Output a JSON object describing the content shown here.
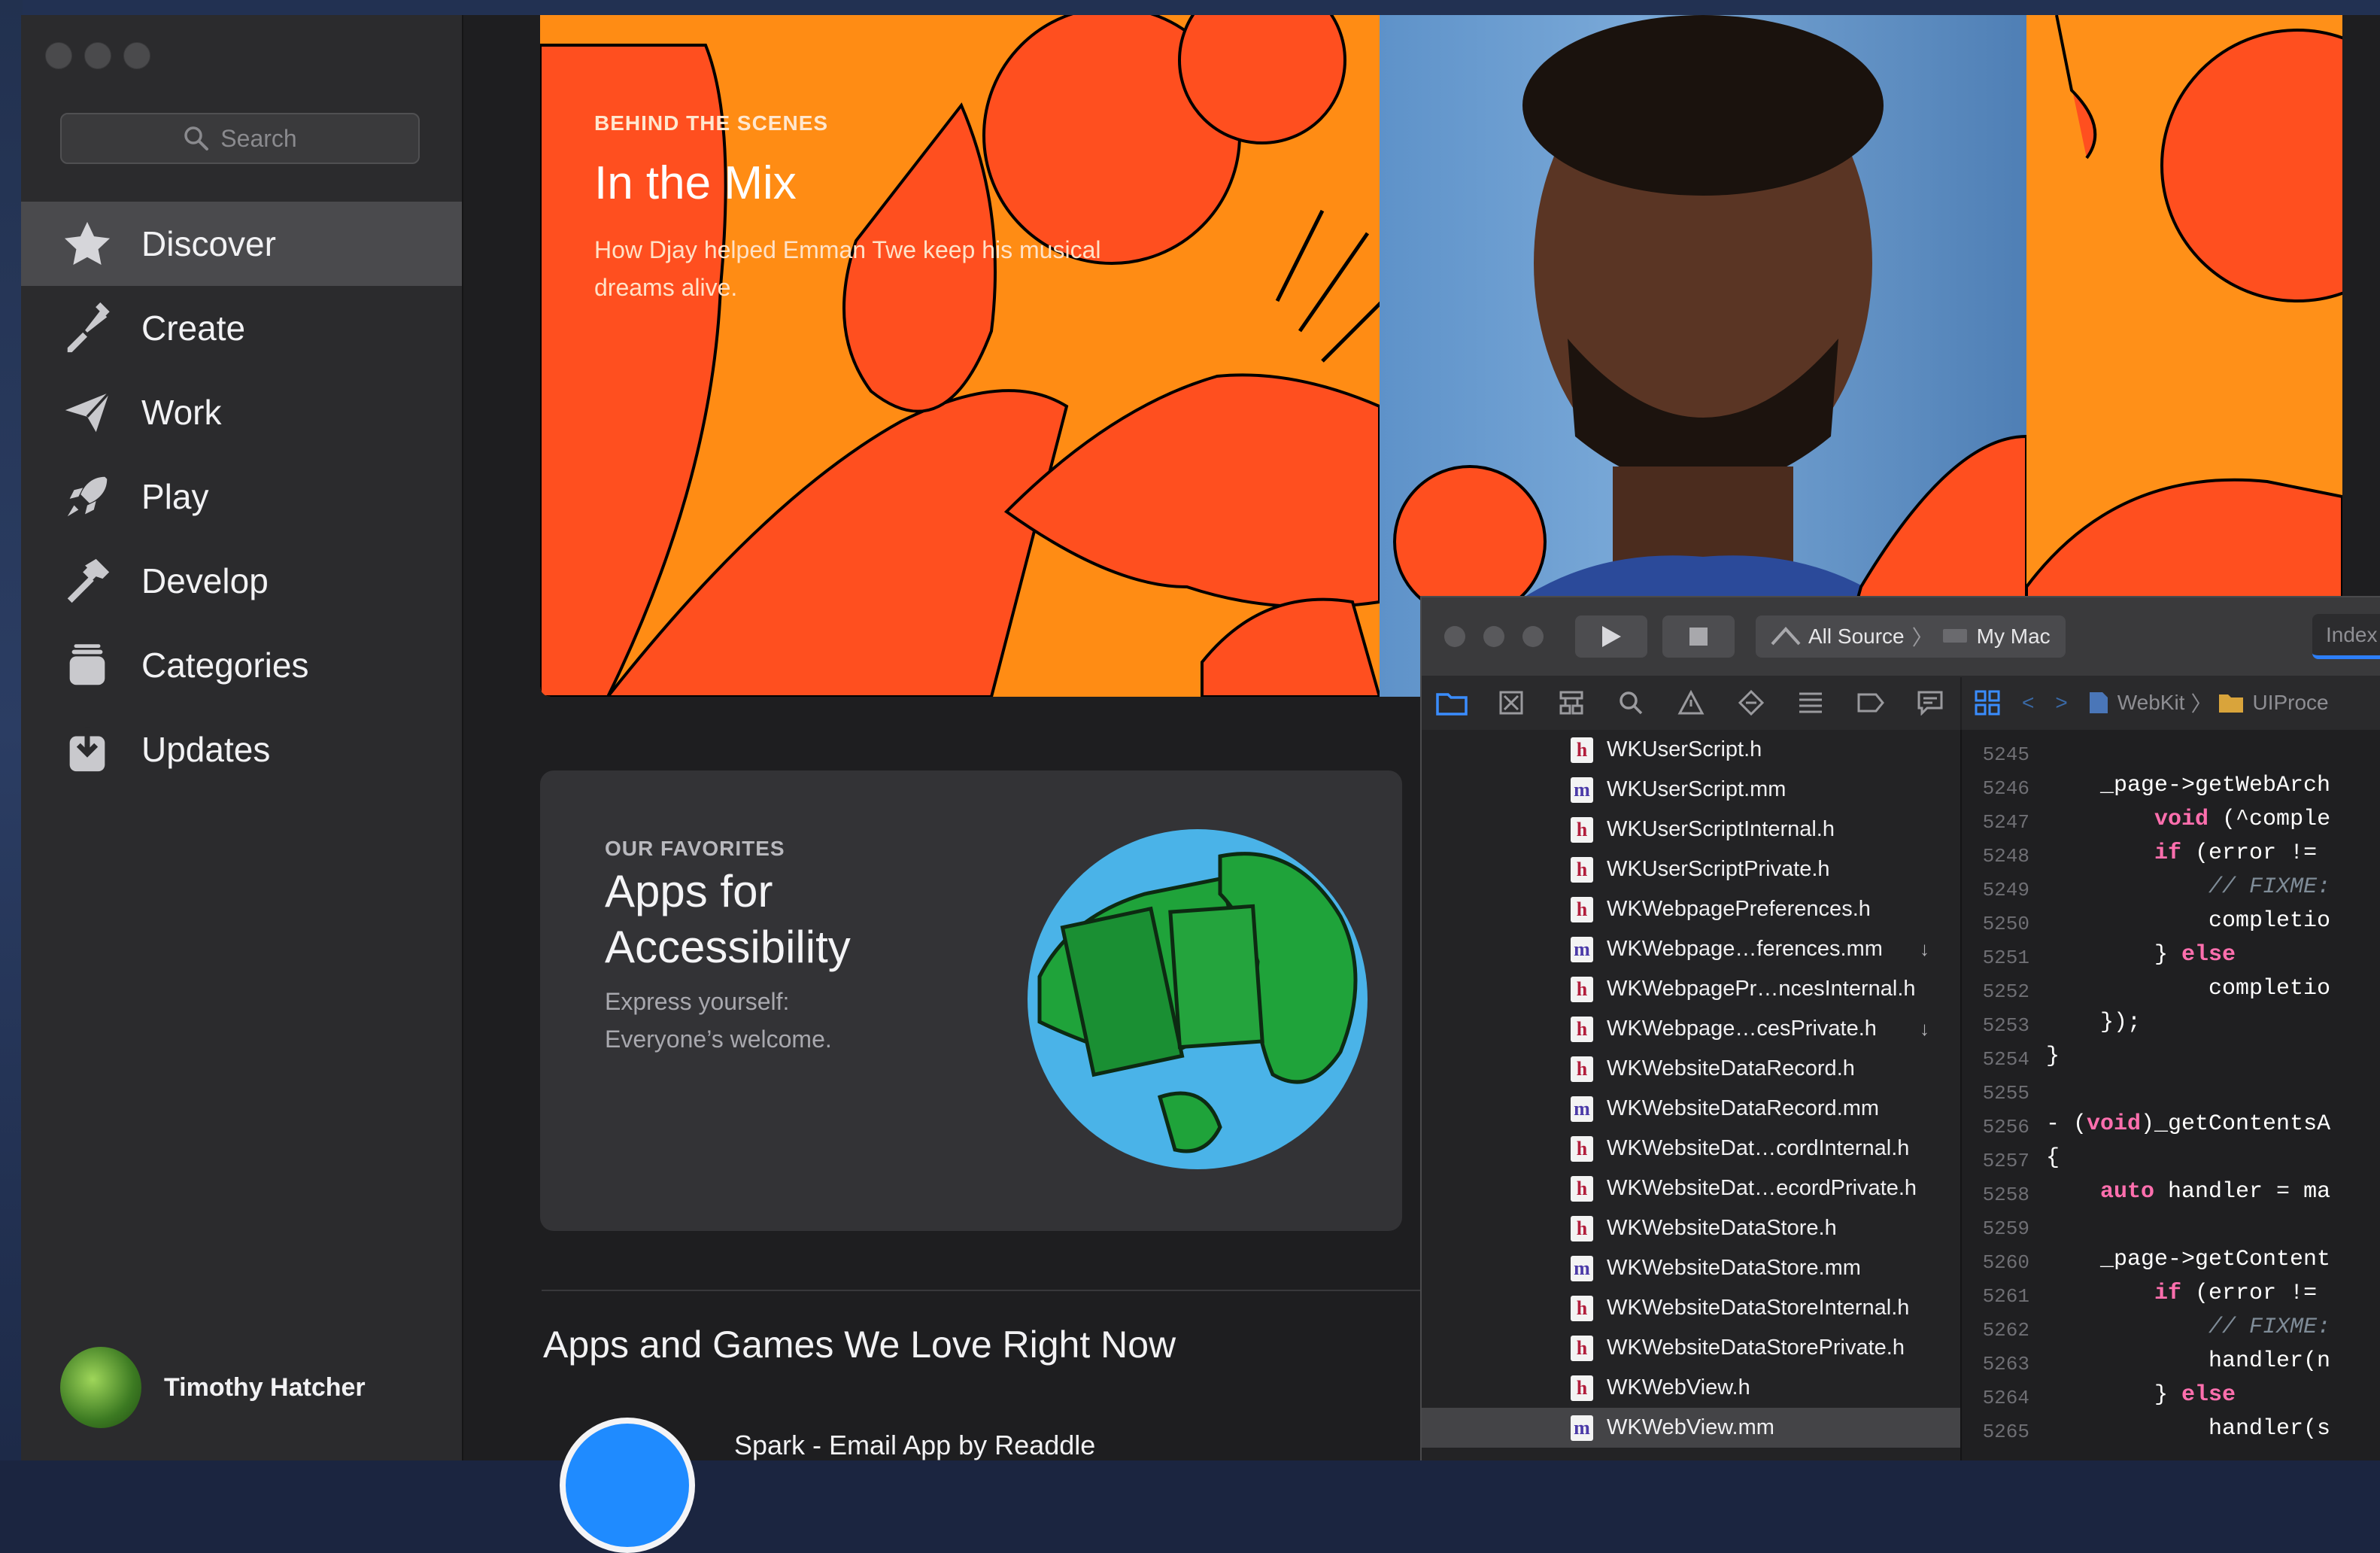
{
  "sidebar": {
    "search_placeholder": "Search",
    "nav": [
      {
        "label": "Discover",
        "icon": "star-icon",
        "active": true
      },
      {
        "label": "Create",
        "icon": "brush-icon"
      },
      {
        "label": "Work",
        "icon": "paper-plane-icon"
      },
      {
        "label": "Play",
        "icon": "rocket-icon"
      },
      {
        "label": "Develop",
        "icon": "hammer-icon"
      },
      {
        "label": "Categories",
        "icon": "stack-icon"
      },
      {
        "label": "Updates",
        "icon": "download-icon"
      }
    ],
    "user_name": "Timothy Hatcher"
  },
  "hero": {
    "eyebrow": "BEHIND THE SCENES",
    "title": "In the Mix",
    "subtitle": "How Djay helped Emman Twe keep his musical dreams alive."
  },
  "favorites": {
    "eyebrow": "OUR FAVORITES",
    "title": "Apps for Accessibility",
    "subtitle": "Express yourself: Everyone’s welcome."
  },
  "section": {
    "title": "Apps and Games We Love Right Now",
    "first_app": "Spark - Email App by Readdle"
  },
  "xcode": {
    "scheme": "All Source",
    "destination": "My Mac",
    "index_label": "Index",
    "breadcrumb": [
      "WebKit",
      "UIProce"
    ],
    "files": [
      {
        "type": "h",
        "name": "WKUserScript.h"
      },
      {
        "type": "m",
        "name": "WKUserScript.mm"
      },
      {
        "type": "h",
        "name": "WKUserScriptInternal.h"
      },
      {
        "type": "h",
        "name": "WKUserScriptPrivate.h"
      },
      {
        "type": "h",
        "name": "WKWebpagePreferences.h"
      },
      {
        "type": "m",
        "name": "WKWebpage…ferences.mm",
        "arrow": true
      },
      {
        "type": "h",
        "name": "WKWebpagePr…ncesInternal.h"
      },
      {
        "type": "h",
        "name": "WKWebpage…cesPrivate.h",
        "arrow": true
      },
      {
        "type": "h",
        "name": "WKWebsiteDataRecord.h"
      },
      {
        "type": "m",
        "name": "WKWebsiteDataRecord.mm"
      },
      {
        "type": "h",
        "name": "WKWebsiteDat…cordInternal.h"
      },
      {
        "type": "h",
        "name": "WKWebsiteDat…ecordPrivate.h"
      },
      {
        "type": "h",
        "name": "WKWebsiteDataStore.h"
      },
      {
        "type": "m",
        "name": "WKWebsiteDataStore.mm"
      },
      {
        "type": "h",
        "name": "WKWebsiteDataStoreInternal.h"
      },
      {
        "type": "h",
        "name": "WKWebsiteDataStorePrivate.h"
      },
      {
        "type": "h",
        "name": "WKWebView.h"
      },
      {
        "type": "m",
        "name": "WKWebView.mm",
        "selected": true
      }
    ],
    "code": [
      {
        "ln": "5245",
        "parts": []
      },
      {
        "ln": "5246",
        "parts": [
          {
            "t": "    _page->getWebArch",
            "c": ""
          }
        ]
      },
      {
        "ln": "5247",
        "parts": [
          {
            "t": "        ",
            "c": ""
          },
          {
            "t": "void",
            "c": "kw"
          },
          {
            "t": " (^comple",
            "c": ""
          }
        ]
      },
      {
        "ln": "5248",
        "parts": [
          {
            "t": "        ",
            "c": ""
          },
          {
            "t": "if",
            "c": "kw"
          },
          {
            "t": " (error !=",
            "c": ""
          }
        ]
      },
      {
        "ln": "5249",
        "parts": [
          {
            "t": "            ",
            "c": ""
          },
          {
            "t": "// FIXME:",
            "c": "cm"
          }
        ]
      },
      {
        "ln": "5250",
        "parts": [
          {
            "t": "            completio",
            "c": ""
          }
        ]
      },
      {
        "ln": "5251",
        "parts": [
          {
            "t": "        } ",
            "c": ""
          },
          {
            "t": "else",
            "c": "kw"
          }
        ]
      },
      {
        "ln": "5252",
        "parts": [
          {
            "t": "            completio",
            "c": ""
          }
        ]
      },
      {
        "ln": "5253",
        "parts": [
          {
            "t": "    });",
            "c": ""
          }
        ]
      },
      {
        "ln": "5254",
        "parts": [
          {
            "t": "}",
            "c": ""
          }
        ]
      },
      {
        "ln": "5255",
        "parts": []
      },
      {
        "ln": "5256",
        "parts": [
          {
            "t": "- (",
            "c": ""
          },
          {
            "t": "void",
            "c": "kw"
          },
          {
            "t": ")_getContentsA",
            "c": ""
          }
        ]
      },
      {
        "ln": "5257",
        "parts": [
          {
            "t": "{",
            "c": ""
          }
        ]
      },
      {
        "ln": "5258",
        "parts": [
          {
            "t": "    ",
            "c": ""
          },
          {
            "t": "auto",
            "c": "kw"
          },
          {
            "t": " handler = ma",
            "c": ""
          }
        ]
      },
      {
        "ln": "5259",
        "parts": []
      },
      {
        "ln": "5260",
        "parts": [
          {
            "t": "    _page->getContent",
            "c": ""
          }
        ]
      },
      {
        "ln": "5261",
        "parts": [
          {
            "t": "        ",
            "c": ""
          },
          {
            "t": "if",
            "c": "kw"
          },
          {
            "t": " (error !=",
            "c": ""
          }
        ]
      },
      {
        "ln": "5262",
        "parts": [
          {
            "t": "            ",
            "c": ""
          },
          {
            "t": "// FIXME:",
            "c": "cm"
          }
        ]
      },
      {
        "ln": "5263",
        "parts": [
          {
            "t": "            handler(n",
            "c": ""
          }
        ]
      },
      {
        "ln": "5264",
        "parts": [
          {
            "t": "        } ",
            "c": ""
          },
          {
            "t": "else",
            "c": "kw"
          }
        ]
      },
      {
        "ln": "5265",
        "parts": [
          {
            "t": "            handler(s",
            "c": ""
          }
        ]
      }
    ]
  }
}
